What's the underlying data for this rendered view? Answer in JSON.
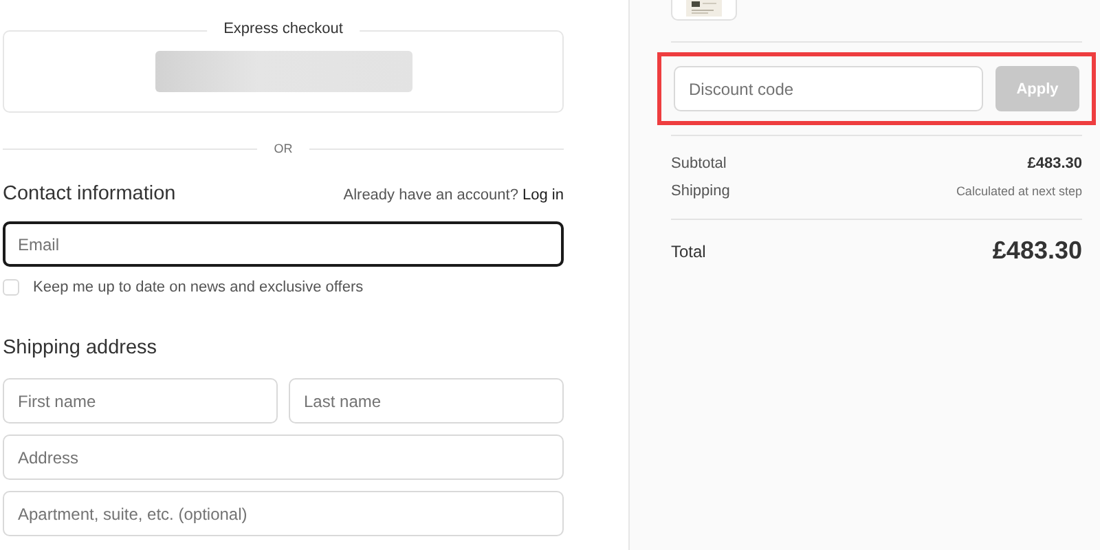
{
  "express_checkout": {
    "title": "Express checkout"
  },
  "divider_label": "OR",
  "contact": {
    "heading": "Contact information",
    "account_prompt": "Already have an account?",
    "login_link": "Log in",
    "email": {
      "placeholder": "Email",
      "focused": true
    },
    "newsletter": {
      "label": "Keep me up to date on news and exclusive offers",
      "checked": false
    }
  },
  "shipping": {
    "heading": "Shipping address",
    "rows": [
      [
        {
          "placeholder": "First name"
        },
        {
          "placeholder": "Last name"
        }
      ],
      [
        {
          "placeholder": "Address"
        }
      ],
      [
        {
          "placeholder": "Apartment, suite, etc. (optional)"
        }
      ]
    ]
  },
  "summary": {
    "discount": {
      "placeholder": "Discount code",
      "button": "Apply",
      "disabled": true,
      "highlighted": true
    },
    "lines": [
      {
        "label": "Subtotal",
        "value": "£483.30",
        "kind": "amount"
      },
      {
        "label": "Shipping",
        "value": "Calculated at next step",
        "kind": "note"
      }
    ],
    "total": {
      "label": "Total",
      "value": "£483.30"
    }
  }
}
